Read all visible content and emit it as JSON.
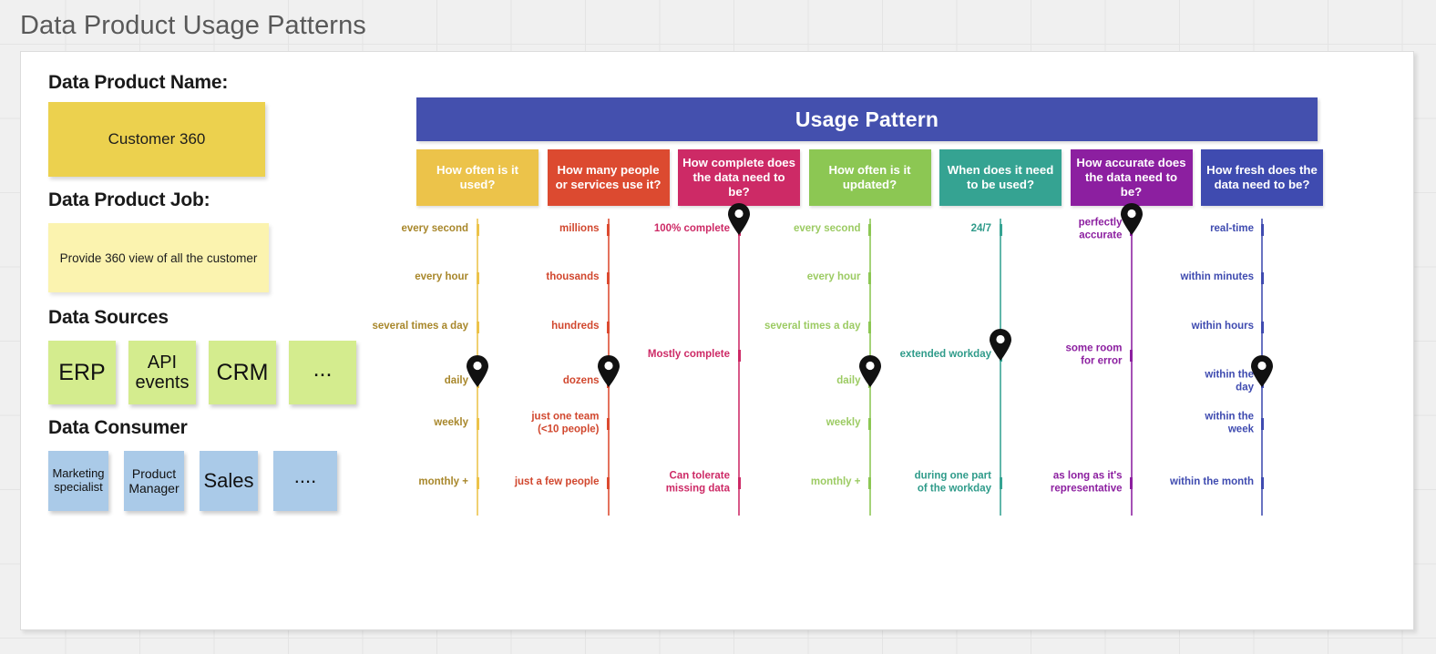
{
  "page": {
    "title": "Data Product Usage Patterns"
  },
  "left_panel": {
    "product_name_heading": "Data Product Name:",
    "product_name": "Customer 360",
    "product_job_heading": "Data Product Job:",
    "product_job": "Provide 360 view of all the customer",
    "data_sources_heading": "Data Sources",
    "data_sources": [
      "ERP",
      "API events",
      "CRM",
      "..."
    ],
    "data_consumer_heading": "Data Consumer",
    "data_consumers": [
      "Marketing specialist",
      "Product Manager",
      "Sales",
      "...."
    ]
  },
  "usage_pattern": {
    "banner_title": "Usage Pattern",
    "banner_color": "#4450ae"
  },
  "chart_data": {
    "type": "scatter",
    "title": "Usage Pattern",
    "note": "Seven vertical ordinal scales; a black map-pin marker indicates the selected level on each scale.",
    "columns": [
      {
        "question": "How often is it used?",
        "color": "#ecc34a",
        "label_color": "#a8872b",
        "scale": [
          "every second",
          "every hour",
          "several times a day",
          "daily",
          "weekly",
          "monthly +"
        ],
        "selected": "daily",
        "selected_index": 3
      },
      {
        "question": "How many people or services use it?",
        "color": "#dc4a30",
        "label_color": "#d1472e",
        "scale": [
          "millions",
          "thousands",
          "hundreds",
          "dozens",
          "just one team\n(<10 people)",
          "just a few people"
        ],
        "selected": "dozens",
        "selected_index": 3
      },
      {
        "question": "How complete does the data need to be?",
        "color": "#cd2a66",
        "label_color": "#cd2a66",
        "scale": [
          "100% complete",
          "Mostly complete",
          "Can tolerate\nmissing data"
        ],
        "selected": "100% complete",
        "selected_index": 0
      },
      {
        "question": "How often is it updated?",
        "color": "#8cc753",
        "label_color": "#9ccb63",
        "scale": [
          "every second",
          "every hour",
          "several times a day",
          "daily",
          "weekly",
          "monthly +"
        ],
        "selected": "daily",
        "selected_index": 3
      },
      {
        "question": "When does it need to be used?",
        "color": "#35a392",
        "label_color": "#2f9b8a",
        "scale": [
          "24/7",
          "extended workday",
          "during one part\nof the workday"
        ],
        "selected": "extended workday",
        "selected_index": 1
      },
      {
        "question": "How accurate does the data need to be?",
        "color": "#8c1fa0",
        "label_color": "#8c1fa0",
        "scale": [
          "perfectly\naccurate",
          "some room\nfor error",
          "as long as it's\nrepresentative"
        ],
        "selected": "perfectly accurate",
        "selected_index": 0
      },
      {
        "question": "How fresh does the data need to be?",
        "color": "#3f4bb0",
        "label_color": "#3f4bb0",
        "scale": [
          "real-time",
          "within minutes",
          "within hours",
          "within the\nday",
          "within the\nweek",
          "within the month"
        ],
        "selected": "within the day",
        "selected_index": 3
      }
    ]
  }
}
